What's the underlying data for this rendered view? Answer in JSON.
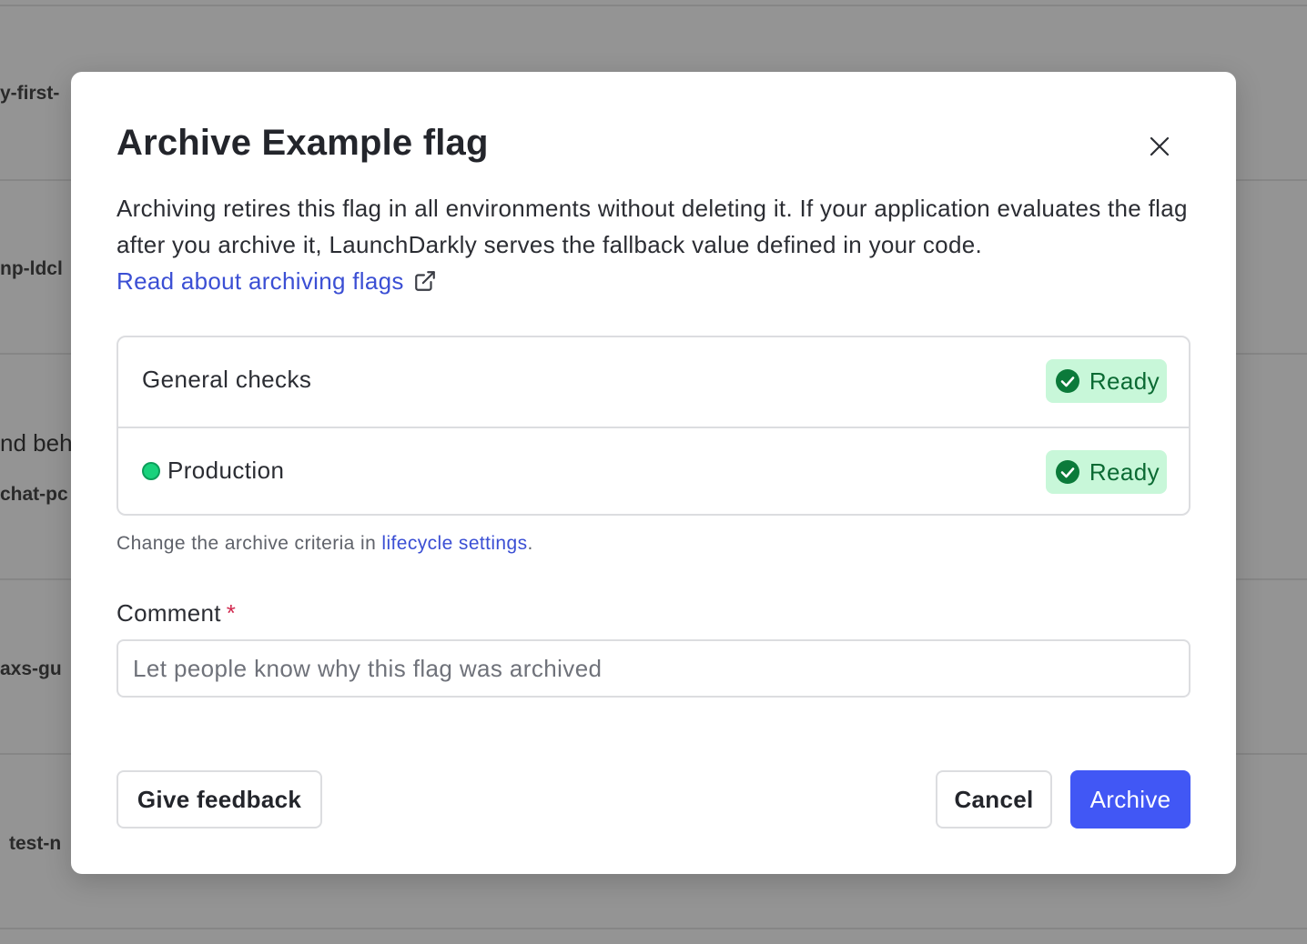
{
  "background": {
    "row_labels": [
      "y-first-",
      "np-ldcl",
      "nd beh",
      "chat-pc",
      "axs-gu",
      "test-n"
    ]
  },
  "modal": {
    "title": "Archive Example flag",
    "description": "Archiving retires this flag in all environments without deleting it. If your application evaluates the flag after you archive it, LaunchDarkly serves the fallback value defined in your code.",
    "docs_link": "Read about archiving flags",
    "checks": [
      {
        "label": "General checks",
        "status": "Ready"
      },
      {
        "label": "Production",
        "status": "Ready",
        "env_color": "#19d27c"
      }
    ],
    "criteria_prefix": "Change the archive criteria in ",
    "criteria_link": "lifecycle settings",
    "criteria_suffix": ".",
    "comment_label": "Comment",
    "comment_required": "*",
    "comment_placeholder": "Let people know why this flag was archived",
    "comment_value": "",
    "feedback_button": "Give feedback",
    "cancel_button": "Cancel",
    "archive_button": "Archive"
  },
  "colors": {
    "primary": "#4157f5",
    "link": "#3b4fd4",
    "ready_bg": "#c8f7d9",
    "ready_text": "#0b6a33",
    "required": "#d12a4f",
    "overlay": "#949494"
  },
  "icons": {
    "close": "close-icon",
    "external": "external-link-icon",
    "ready": "check-circle-icon"
  }
}
